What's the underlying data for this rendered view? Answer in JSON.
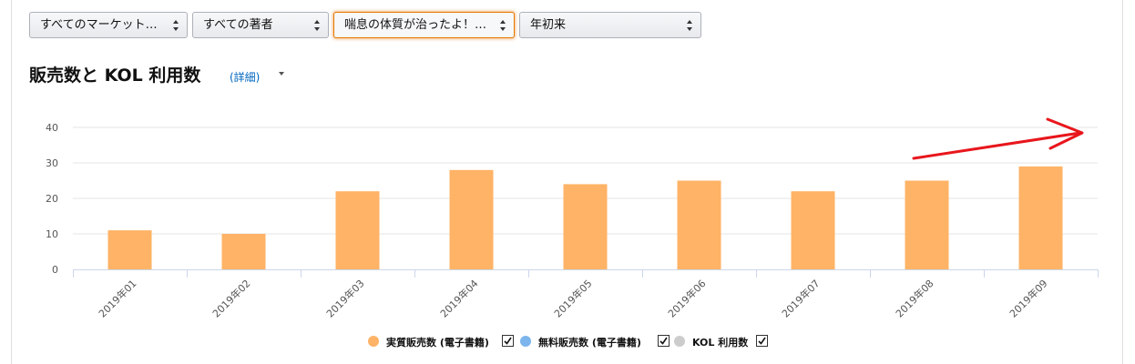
{
  "filters": {
    "market": "すべてのマーケット…",
    "author": "すべての著者",
    "title": "喘息の体質が治ったよ！…",
    "period": "年初来"
  },
  "section": {
    "title": "販売数と KOL 利用数",
    "detail_link": "(詳細)"
  },
  "chart_data": {
    "type": "bar",
    "categories": [
      "2019年01",
      "2019年02",
      "2019年03",
      "2019年04",
      "2019年05",
      "2019年06",
      "2019年07",
      "2019年08",
      "2019年09"
    ],
    "series": [
      {
        "name": "実質販売数 (電子書籍)",
        "values": [
          11,
          10,
          22,
          28,
          24,
          25,
          22,
          25,
          29
        ],
        "color": "#ffb366"
      },
      {
        "name": "無料販売数 (電子書籍)",
        "values": [],
        "color": "#7cb5ec"
      },
      {
        "name": "KOL 利用数",
        "values": [],
        "color": "#cccccc"
      }
    ],
    "yticks": [
      "0",
      "10",
      "20",
      "30",
      "40"
    ],
    "ylim": [
      0,
      40
    ],
    "grid": true,
    "legend_position": "bottom"
  },
  "legend": [
    {
      "label": "実質販売数 (電子書籍)",
      "color": "#ffb366",
      "checked": true
    },
    {
      "label": "無料販売数 (電子書籍)",
      "color": "#7cb5ec",
      "checked": true
    },
    {
      "label": "KOL 利用数",
      "color": "#cccccc",
      "checked": true
    }
  ],
  "annotation": {
    "type": "red-arrow",
    "color": "#e8161c"
  }
}
